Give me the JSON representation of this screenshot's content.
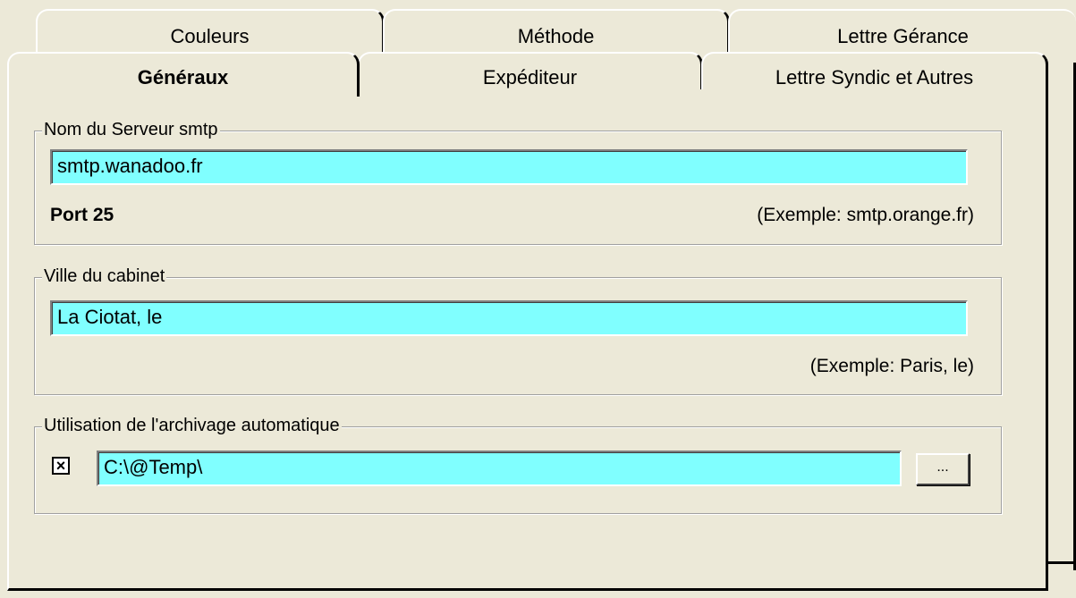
{
  "tabs": {
    "back_row": [
      "Couleurs",
      "Méthode",
      "Lettre Gérance"
    ],
    "front_row": [
      "Généraux",
      "Expéditeur",
      "Lettre Syndic et Autres"
    ],
    "active": "Généraux"
  },
  "smtp_group": {
    "legend": "Nom du Serveur smtp",
    "value": "smtp.wanadoo.fr",
    "port_label": "Port 25",
    "example": "(Exemple: smtp.orange.fr)"
  },
  "city_group": {
    "legend": "Ville du cabinet",
    "value": "La Ciotat, le",
    "example": "(Exemple: Paris, le)"
  },
  "archive_group": {
    "legend": "Utilisation de l'archivage automatique",
    "checked": true,
    "check_mark": "×",
    "path": "C:\\@Temp\\",
    "browse_label": "..."
  },
  "colors": {
    "field_background": "#80ffff",
    "window_background": "#ece9d8"
  }
}
